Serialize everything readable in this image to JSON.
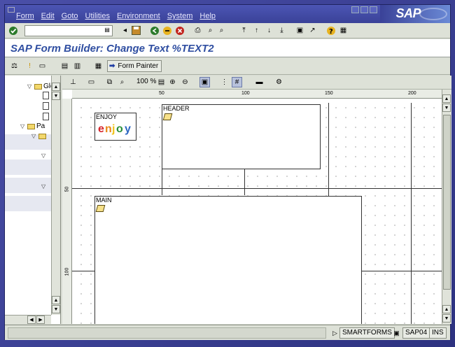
{
  "menu": {
    "items": [
      "Form",
      "Edit",
      "Goto",
      "Utilities",
      "Environment",
      "System",
      "Help"
    ]
  },
  "brand": {
    "logo": "SAP"
  },
  "title": "SAP Form Builder: Change Text %TEXT2",
  "app_toolbar": {
    "form_painter_label": "Form Painter"
  },
  "tree": {
    "nodes": [
      {
        "label": "Glo",
        "kind": "folder",
        "level": 0
      },
      {
        "label": "",
        "kind": "doc",
        "level": 1
      },
      {
        "label": "",
        "kind": "doc",
        "level": 1
      },
      {
        "label": "",
        "kind": "doc",
        "level": 1
      },
      {
        "label": "Pa",
        "kind": "folder",
        "level": 0
      },
      {
        "label": "",
        "kind": "folder",
        "level": 1
      }
    ]
  },
  "painter": {
    "zoom": "100 %",
    "ruler_h": [
      "50",
      "100",
      "150",
      "200"
    ],
    "ruler_v": [
      "50",
      "100"
    ],
    "windows": [
      {
        "label": "ENJOY"
      },
      {
        "label": "HEADER"
      },
      {
        "label": "MAIN"
      }
    ],
    "enjoy_logo": "enjoy"
  },
  "status": {
    "system": "SMARTFORMS",
    "client": "SAP04",
    "mode": "INS"
  }
}
